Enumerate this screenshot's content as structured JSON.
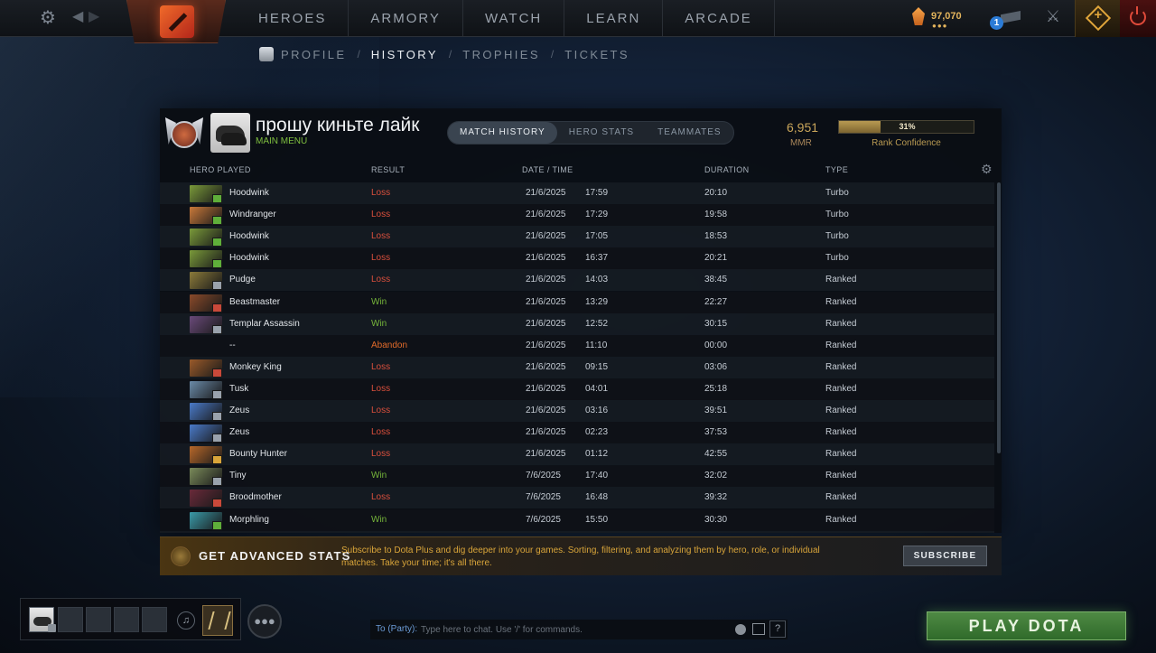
{
  "topbar": {
    "nav": [
      "HEROES",
      "ARMORY",
      "WATCH",
      "LEARN",
      "ARCADE"
    ],
    "currency": "97,070",
    "notifications": "1",
    "icons": [
      "gear-icon",
      "back-arrow-icon",
      "forward-arrow-icon",
      "dota-logo-icon",
      "shard-icon",
      "mail-icon",
      "armory-icon",
      "plus-icon",
      "power-icon"
    ]
  },
  "subnav": {
    "items": [
      "PROFILE",
      "HISTORY",
      "TROPHIES",
      "TICKETS"
    ],
    "active": "HISTORY",
    "sep": "/"
  },
  "profile": {
    "name": "прошу киньте лайк",
    "subtitle": "MAIN MENU",
    "tabs": [
      "MATCH HISTORY",
      "HERO STATS",
      "TEAMMATES"
    ],
    "active_tab": "MATCH HISTORY",
    "mmr": "6,951",
    "mmr_label": "MMR",
    "confidence_pct": "31%",
    "confidence_value": 31,
    "confidence_label": "Rank Confidence"
  },
  "columns": [
    "HERO PLAYED",
    "RESULT",
    "DATE / TIME",
    "DURATION",
    "TYPE"
  ],
  "matches": [
    {
      "hero": "Hoodwink",
      "result": "Loss",
      "date": "21/6/2025",
      "time": "17:59",
      "duration": "20:10",
      "type": "Turbo",
      "color": "#7a9a3a",
      "role_color": "#5fae3a"
    },
    {
      "hero": "Windranger",
      "result": "Loss",
      "date": "21/6/2025",
      "time": "17:29",
      "duration": "19:58",
      "type": "Turbo",
      "color": "#c9793a",
      "role_color": "#5fae3a"
    },
    {
      "hero": "Hoodwink",
      "result": "Loss",
      "date": "21/6/2025",
      "time": "17:05",
      "duration": "18:53",
      "type": "Turbo",
      "color": "#7a9a3a",
      "role_color": "#5fae3a"
    },
    {
      "hero": "Hoodwink",
      "result": "Loss",
      "date": "21/6/2025",
      "time": "16:37",
      "duration": "20:21",
      "type": "Turbo",
      "color": "#7a9a3a",
      "role_color": "#5fae3a"
    },
    {
      "hero": "Pudge",
      "result": "Loss",
      "date": "21/6/2025",
      "time": "14:03",
      "duration": "38:45",
      "type": "Ranked",
      "color": "#8a7a3a",
      "role_color": "#9aa2ac"
    },
    {
      "hero": "Beastmaster",
      "result": "Win",
      "date": "21/6/2025",
      "time": "13:29",
      "duration": "22:27",
      "type": "Ranked",
      "color": "#8a4a2a",
      "role_color": "#c9493a"
    },
    {
      "hero": "Templar Assassin",
      "result": "Win",
      "date": "21/6/2025",
      "time": "12:52",
      "duration": "30:15",
      "type": "Ranked",
      "color": "#6a4a7a",
      "role_color": "#9aa2ac"
    },
    {
      "hero": "--",
      "result": "Abandon",
      "date": "21/6/2025",
      "time": "11:10",
      "duration": "00:00",
      "type": "Ranked",
      "color": "",
      "role_color": ""
    },
    {
      "hero": "Monkey King",
      "result": "Loss",
      "date": "21/6/2025",
      "time": "09:15",
      "duration": "03:06",
      "type": "Ranked",
      "color": "#9a5a2a",
      "role_color": "#c9493a"
    },
    {
      "hero": "Tusk",
      "result": "Loss",
      "date": "21/6/2025",
      "time": "04:01",
      "duration": "25:18",
      "type": "Ranked",
      "color": "#6a8aa8",
      "role_color": "#9aa2ac"
    },
    {
      "hero": "Zeus",
      "result": "Loss",
      "date": "21/6/2025",
      "time": "03:16",
      "duration": "39:51",
      "type": "Ranked",
      "color": "#4a7ac8",
      "role_color": "#9aa2ac"
    },
    {
      "hero": "Zeus",
      "result": "Loss",
      "date": "21/6/2025",
      "time": "02:23",
      "duration": "37:53",
      "type": "Ranked",
      "color": "#4a7ac8",
      "role_color": "#9aa2ac"
    },
    {
      "hero": "Bounty Hunter",
      "result": "Loss",
      "date": "21/6/2025",
      "time": "01:12",
      "duration": "42:55",
      "type": "Ranked",
      "color": "#b8682a",
      "role_color": "#d9a53a"
    },
    {
      "hero": "Tiny",
      "result": "Win",
      "date": "7/6/2025",
      "time": "17:40",
      "duration": "32:02",
      "type": "Ranked",
      "color": "#7a8a5a",
      "role_color": "#9aa2ac"
    },
    {
      "hero": "Broodmother",
      "result": "Loss",
      "date": "7/6/2025",
      "time": "16:48",
      "duration": "39:32",
      "type": "Ranked",
      "color": "#6a2a3a",
      "role_color": "#c9493a"
    },
    {
      "hero": "Morphling",
      "result": "Win",
      "date": "7/6/2025",
      "time": "15:50",
      "duration": "30:30",
      "type": "Ranked",
      "color": "#3a9aa8",
      "role_color": "#5fae3a"
    },
    {
      "hero": "",
      "result": "",
      "date": "",
      "time": "",
      "duration": "",
      "type": "",
      "color": "#5a4a3a",
      "role_color": ""
    }
  ],
  "advanced": {
    "title": "GET ADVANCED STATS",
    "description": "Subscribe to Dota Plus and dig deeper into your games. Sorting, filtering, and analyzing them by hero, role, or individual matches. Take your time; it's all there.",
    "button": "SUBSCRIBE"
  },
  "chat": {
    "label": "To (Party):",
    "placeholder": "Type here to chat. Use '/' for commands.",
    "help": "?"
  },
  "play_button": "PLAY DOTA"
}
